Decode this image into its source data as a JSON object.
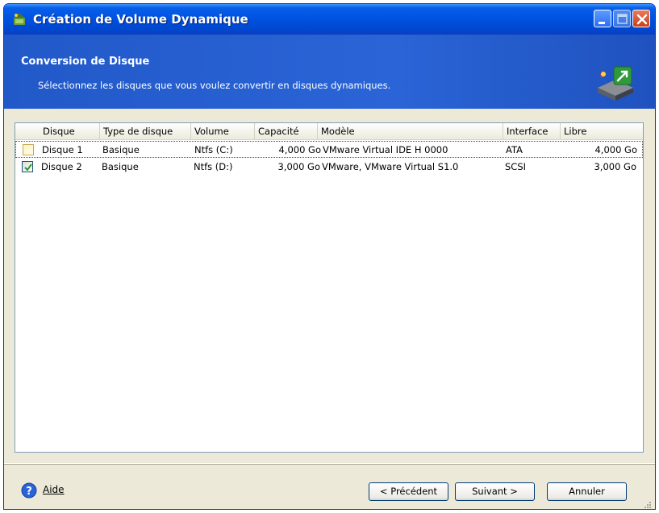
{
  "window": {
    "title": "Création de Volume Dynamique",
    "colors": {
      "titlebar": "#0055e5",
      "header": "#2a64d6",
      "face": "#ece9d8"
    }
  },
  "header": {
    "title": "Conversion de Disque",
    "subtitle": "Sélectionnez les disques que vous voulez convertir en disques dynamiques."
  },
  "table": {
    "columns": [
      "Disque",
      "Type de disque",
      "Volume",
      "Capacité",
      "Modèle",
      "Interface",
      "Libre"
    ],
    "rows": [
      {
        "checked": false,
        "disk": "Disque 1",
        "type": "Basique",
        "volume": "Ntfs (C:)",
        "capacity": "4,000 Go",
        "model": "VMware Virtual IDE H 0000",
        "interface": "ATA",
        "free": "4,000 Go"
      },
      {
        "checked": true,
        "disk": "Disque 2",
        "type": "Basique",
        "volume": "Ntfs (D:)",
        "capacity": "3,000 Go",
        "model": "VMware, VMware Virtual S1.0",
        "interface": "SCSI",
        "free": "3,000 Go"
      }
    ]
  },
  "footer": {
    "help_label": "Aide",
    "prev_label": "< Précédent",
    "next_label": "Suivant >",
    "cancel_label": "Annuler"
  }
}
